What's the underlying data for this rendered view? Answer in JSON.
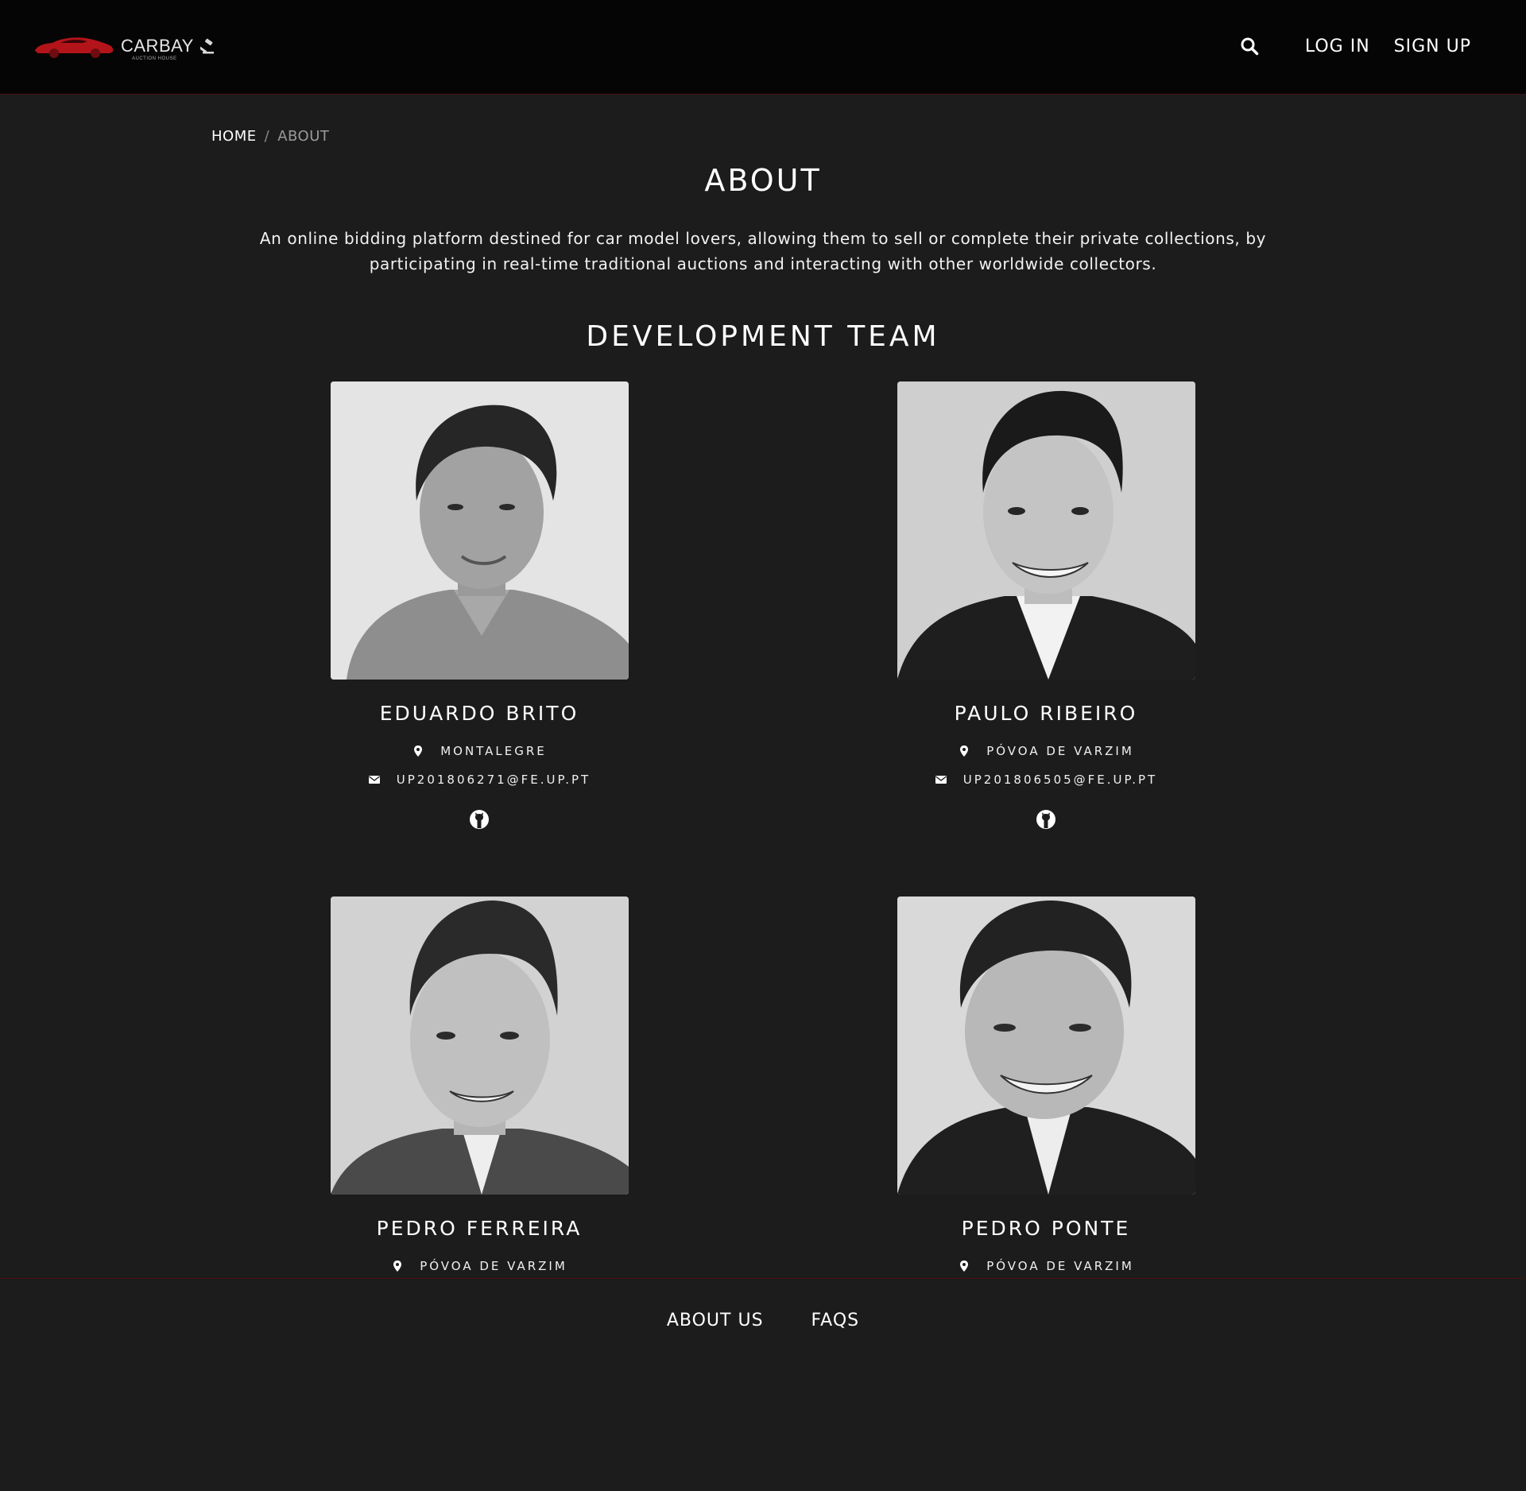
{
  "colors": {
    "nav_bg": "#050505",
    "page_bg": "#1c1c1c",
    "brand_red": "#c0171b",
    "border_red": "#4a1010"
  },
  "brand": {
    "name": "CARBAY",
    "subtitle": "AUCTION HOUSE"
  },
  "nav": {
    "search_icon": "search-icon",
    "login": "LOG IN",
    "signup": "SIGN UP"
  },
  "breadcrumb": {
    "home": "HOME",
    "separator": "/",
    "current": "ABOUT"
  },
  "page": {
    "title": "ABOUT",
    "intro": "An online bidding platform destined for car model lovers, allowing them to sell or complete their private collections, by participating in real-time traditional auctions and interacting with other worldwide collectors.",
    "team_title": "DEVELOPMENT TEAM"
  },
  "members": [
    {
      "name": "EDUARDO BRITO",
      "location": "MONTALEGRE",
      "email": "UP201806271@FE.UP.PT"
    },
    {
      "name": "PAULO RIBEIRO",
      "location": "PÓVOA DE VARZIM",
      "email": "UP201806505@FE.UP.PT"
    },
    {
      "name": "PEDRO FERREIRA",
      "location": "PÓVOA DE VARZIM"
    },
    {
      "name": "PEDRO PONTE",
      "location": "PÓVOA DE VARZIM"
    }
  ],
  "footer": {
    "about_us": "ABOUT US",
    "faqs": "FAQS"
  }
}
